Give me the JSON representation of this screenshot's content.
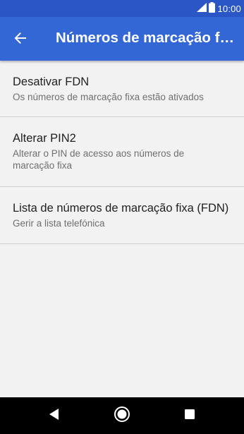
{
  "status_bar": {
    "time": "10:00",
    "signal_icon": "signal-icon",
    "battery_icon": "battery-icon"
  },
  "app_bar": {
    "back_icon": "arrow-back-icon",
    "title": "Números de marcação fixa"
  },
  "settings": {
    "items": [
      {
        "title": "Desativar FDN",
        "subtitle": "Os números de marcação fixa estão ativados"
      },
      {
        "title": "Alterar PIN2",
        "subtitle": "Alterar o PIN de acesso aos números de marcação fixa"
      },
      {
        "title": "Lista de números de marcação fixa (FDN)",
        "subtitle": "Gerir a lista telefónica"
      }
    ]
  },
  "nav_bar": {
    "back_icon": "nav-back-icon",
    "home_icon": "nav-home-icon",
    "recents_icon": "nav-recents-icon"
  },
  "colors": {
    "status_bar": "#2a56c6",
    "app_bar": "#3367d6",
    "background": "#f2f2f2",
    "nav_bar": "#000000"
  }
}
